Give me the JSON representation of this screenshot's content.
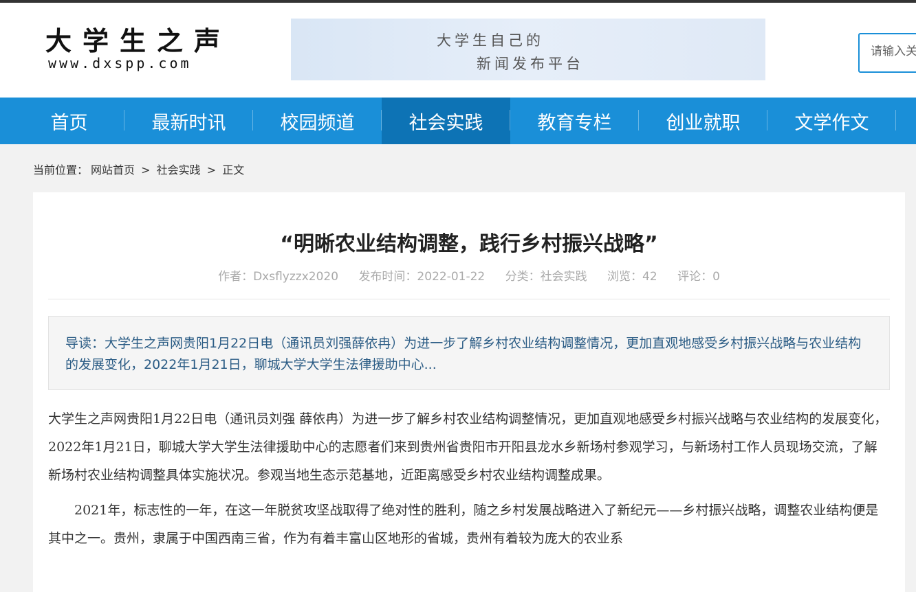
{
  "site": {
    "logo_title": "大学生之声",
    "logo_url": "www.dxspp.com",
    "banner_line1": "大学生自己的",
    "banner_line2": "新闻发布平台",
    "search_placeholder": "请输入关键词"
  },
  "nav": {
    "items": [
      {
        "label": "首页"
      },
      {
        "label": "最新时讯"
      },
      {
        "label": "校园频道"
      },
      {
        "label": "社会实践"
      },
      {
        "label": "教育专栏"
      },
      {
        "label": "创业就职"
      },
      {
        "label": "文学作文"
      }
    ],
    "active": "社会实践"
  },
  "breadcrumb": {
    "prefix": "当前位置：",
    "home": "网站首页",
    "sep1": ">",
    "category": "社会实践",
    "sep2": ">",
    "current": "正文"
  },
  "article": {
    "title": "“明晰农业结构调整，践行乡村振兴战略”",
    "meta": {
      "author": "作者：Dxsflyzzx2020",
      "date": "发布时间：2022-01-22",
      "category": "分类：社会实践",
      "views": "浏览：42",
      "comments": "评论：0"
    },
    "lead": "导读：大学生之声网贵阳1月22日电（通讯员刘强薛依冉）为进一步了解乡村农业结构调整情况，更加直观地感受乡村振兴战略与农业结构的发展变化，2022年1月21日，聊城大学大学生法律援助中心...",
    "paragraphs": [
      "大学生之声网贵阳1月22日电（通讯员刘强 薛依冉）为进一步了解乡村农业结构调整情况，更加直观地感受乡村振兴战略与农业结构的发展变化，2022年1月21日，聊城大学大学生法律援助中心的志愿者们来到贵州省贵阳市开阳县龙水乡新场村参观学习，与新场村工作人员现场交流，了解新场村农业结构调整具体实施状况。参观当地生态示范基地，近距离感受乡村农业结构调整成果。",
      "2021年，标志性的一年，在这一年脱贫攻坚战取得了绝对性的胜利，随之乡村发展战略进入了新纪元——乡村振兴战略，调整农业结构便是其中之一。贵州，隶属于中国西南三省，作为有着丰富山区地形的省城，贵州有着较为庞大的农业系"
    ]
  }
}
